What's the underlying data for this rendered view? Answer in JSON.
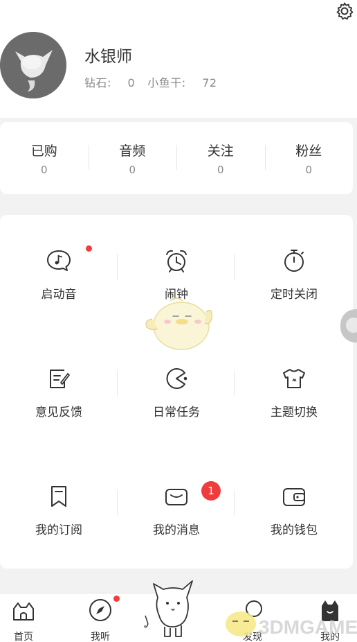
{
  "header": {
    "username": "水银师",
    "diamond_label": "钻石:",
    "diamond_value": "0",
    "fish_label": "小鱼干:",
    "fish_value": "72",
    "settings_icon": "gear-icon"
  },
  "counts": [
    {
      "label": "已购",
      "value": "0"
    },
    {
      "label": "音频",
      "value": "0"
    },
    {
      "label": "关注",
      "value": "0"
    },
    {
      "label": "粉丝",
      "value": "0"
    }
  ],
  "menu": [
    {
      "label": "启动音",
      "icon": "music-bubble-icon",
      "has_dot": true
    },
    {
      "label": "闹钟",
      "icon": "alarm-clock-icon"
    },
    {
      "label": "定时关闭",
      "icon": "timer-icon"
    },
    {
      "label": "意见反馈",
      "icon": "feedback-icon"
    },
    {
      "label": "日常任务",
      "icon": "pacman-task-icon"
    },
    {
      "label": "主题切换",
      "icon": "tshirt-icon"
    },
    {
      "label": "我的订阅",
      "icon": "bookmark-icon"
    },
    {
      "label": "我的消息",
      "icon": "message-icon",
      "badge": "1"
    },
    {
      "label": "我的钱包",
      "icon": "wallet-icon"
    }
  ],
  "tabs": [
    {
      "label": "首页",
      "icon": "home-cat-icon"
    },
    {
      "label": "我听",
      "icon": "compass-icon",
      "has_dot": true
    },
    {
      "label": "发现",
      "icon": "discover-icon"
    },
    {
      "label": "我的",
      "icon": "profile-cat-icon"
    }
  ],
  "watermark": "3DMGAME",
  "colors": {
    "accent_red": "#f03c3c",
    "text": "#333333",
    "muted": "#888888"
  }
}
